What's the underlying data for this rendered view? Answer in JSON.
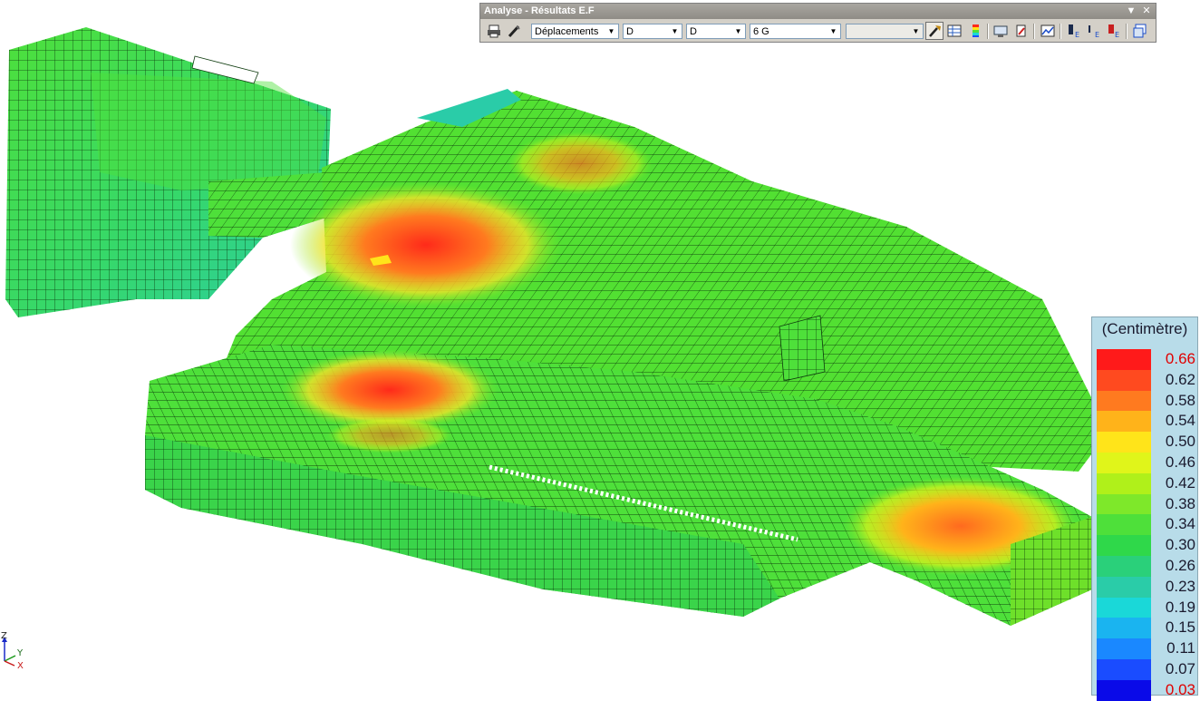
{
  "toolbar": {
    "title": "Analyse - Résultats E.F",
    "result_type": "Déplacements",
    "component_1": "D",
    "component_2": "D",
    "load_case": "6 G",
    "extra_select": "",
    "icons": [
      "print-icon",
      "pen-icon",
      "pointer-icon",
      "table-icon",
      "gradient-scale-icon",
      "display-options-icon",
      "animation-icon",
      "line-graph-icon",
      "element-label-icon",
      "inertia-label-icon",
      "elevation-label-icon",
      "window-icon"
    ]
  },
  "legend": {
    "title": "(Centimètre)",
    "values": [
      "0.66",
      "0.62",
      "0.58",
      "0.54",
      "0.50",
      "0.46",
      "0.42",
      "0.38",
      "0.34",
      "0.30",
      "0.26",
      "0.23",
      "0.19",
      "0.15",
      "0.11",
      "0.07",
      "0.03"
    ],
    "colors": [
      "#ff1a1a",
      "#ff4a1f",
      "#ff7a1f",
      "#ffb31a",
      "#ffe41a",
      "#e0f51a",
      "#b0f01a",
      "#7ee82a",
      "#4ee03a",
      "#2fd84a",
      "#2ad07a",
      "#2acca8",
      "#1ad8d8",
      "#1ab4f0",
      "#1a88ff",
      "#1a4cff",
      "#0a0ae8"
    ]
  },
  "axes": {
    "z": "Z",
    "y": "Y",
    "x": "X"
  }
}
